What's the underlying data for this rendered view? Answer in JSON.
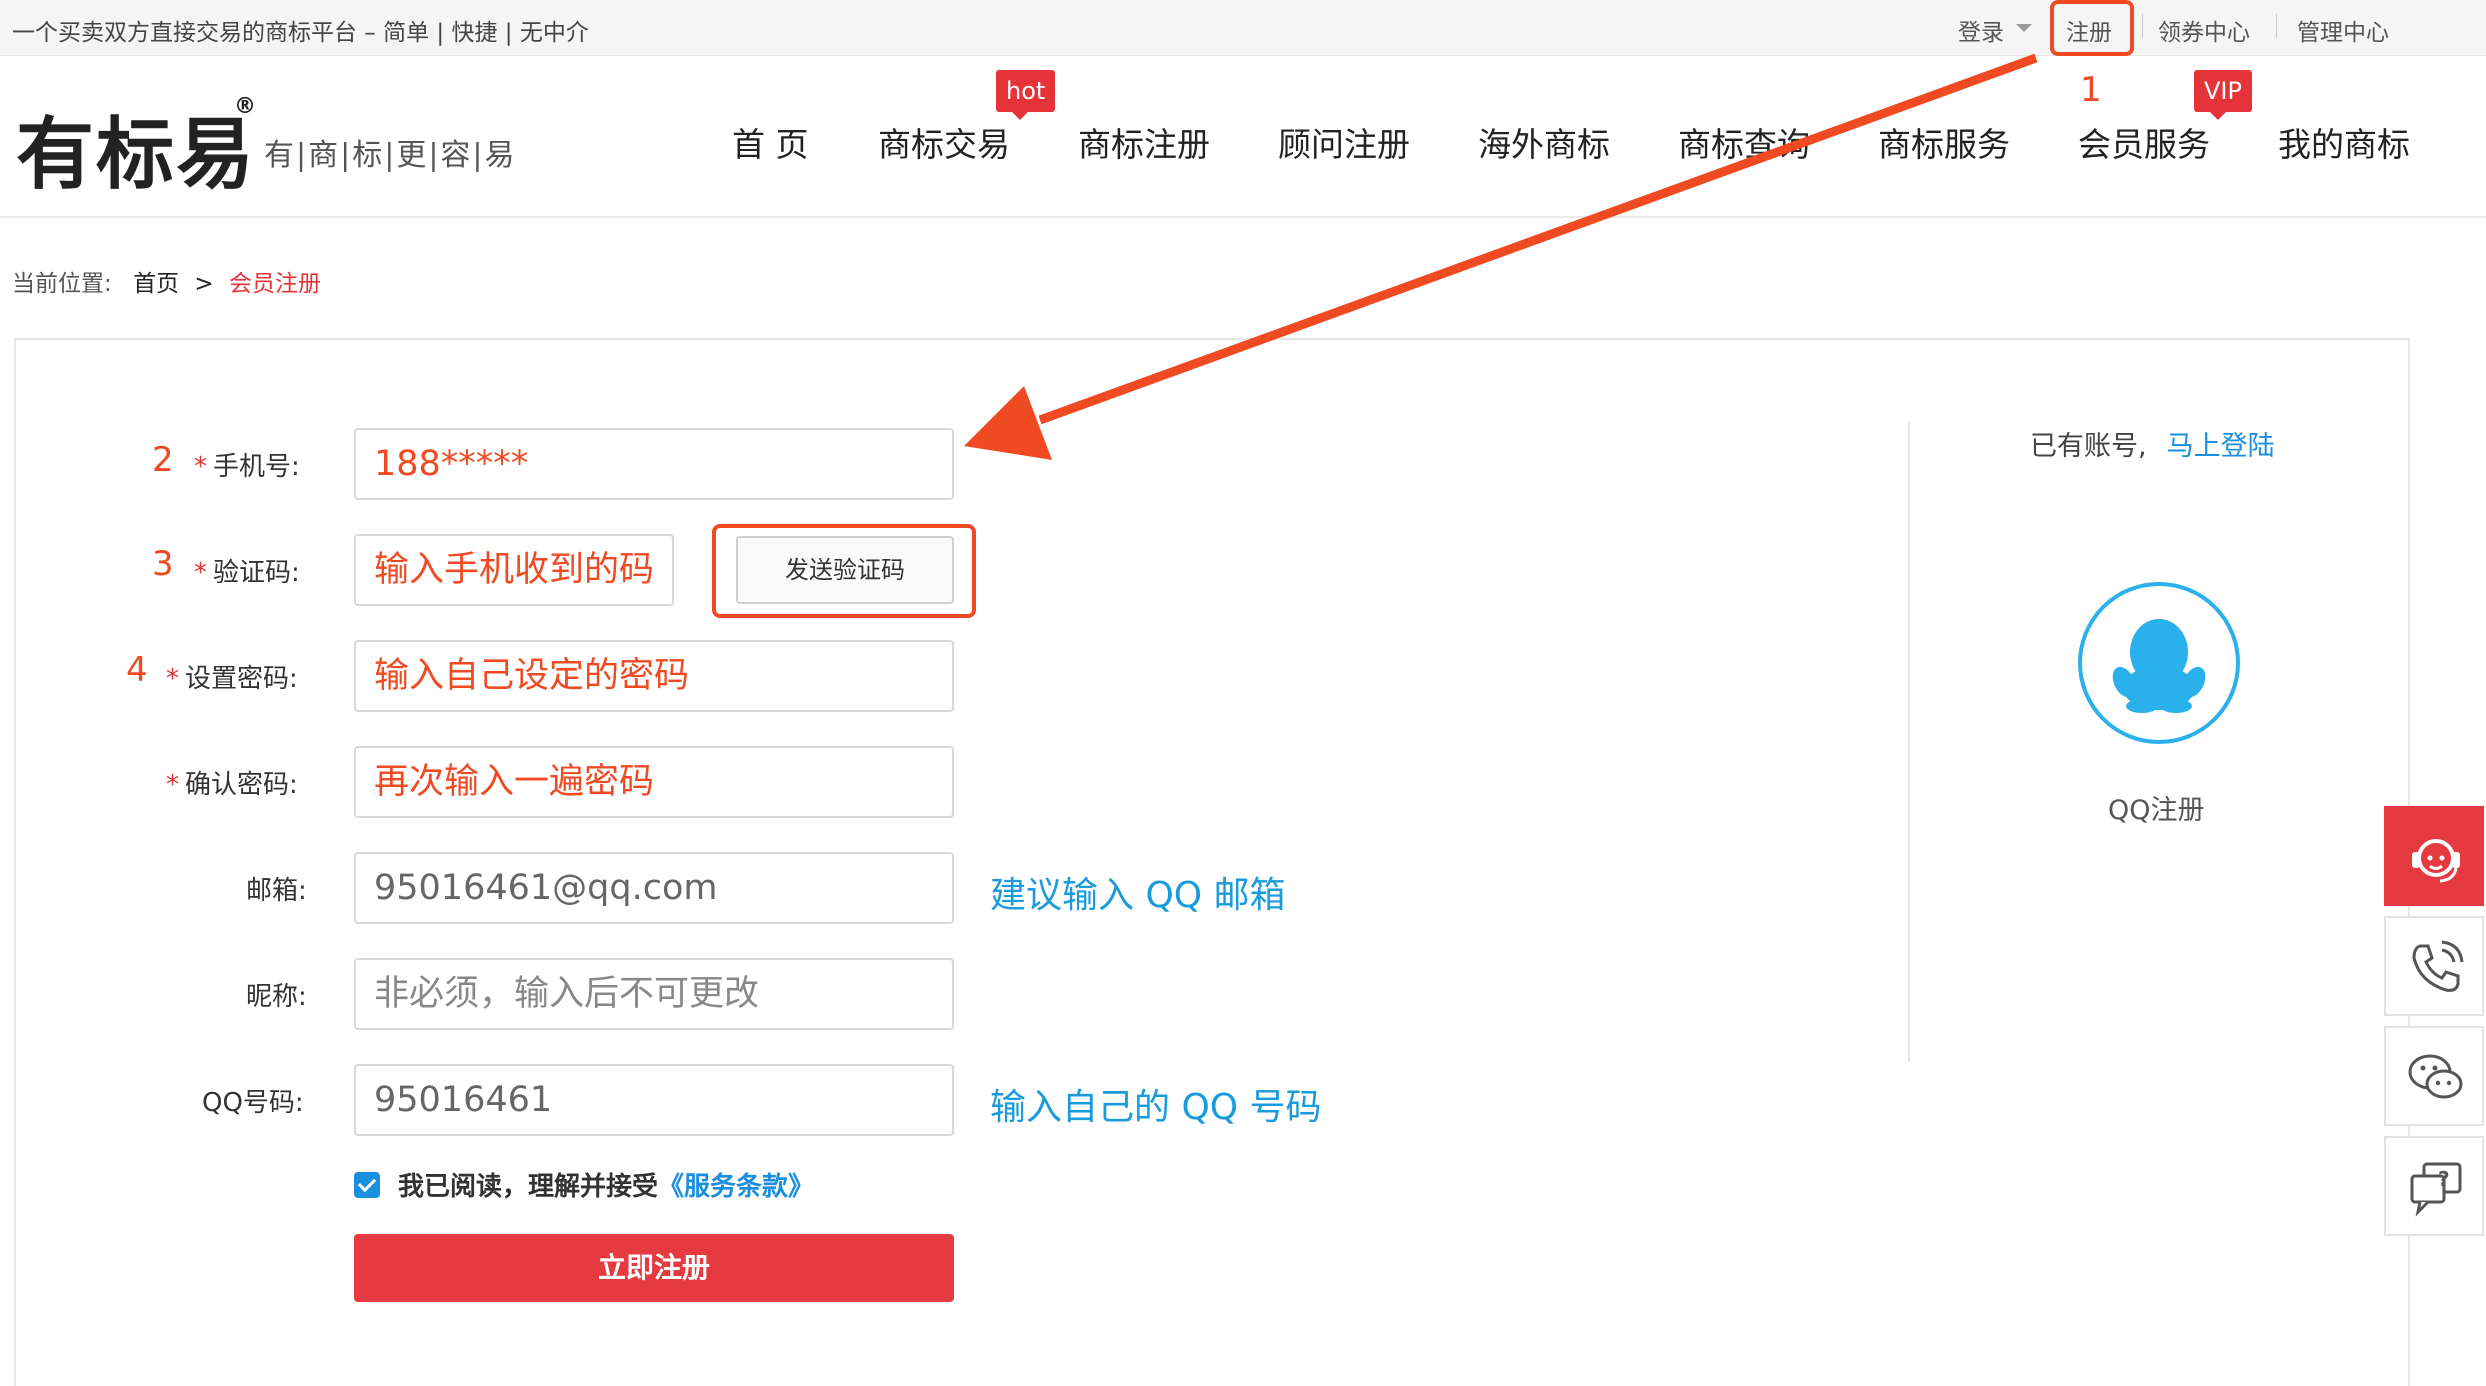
{
  "topbar": {
    "slogan": "一个买卖双方直接交易的商标平台 – 简单 | 快捷 | 无中介",
    "login": "登录",
    "register": "注册",
    "coupon": "领券中心",
    "manage": "管理中心"
  },
  "logo": {
    "name": "有标易",
    "reg": "®",
    "tagline": "有|商|标|更|容|易"
  },
  "nav": {
    "items": [
      "首 页",
      "商标交易",
      "商标注册",
      "顾问注册",
      "海外商标",
      "商标查询",
      "商标服务",
      "会员服务",
      "我的商标"
    ],
    "badges": {
      "hot": "hot",
      "vip": "VIP"
    }
  },
  "annotations": {
    "n1": "1",
    "n2": "2",
    "n3": "3",
    "n4": "4"
  },
  "breadcrumb": {
    "label": "当前位置:",
    "home": "首页",
    "sep": ">",
    "current": "会员注册"
  },
  "form": {
    "phone": {
      "label": "手机号:",
      "value": "188*****"
    },
    "code": {
      "label": "验证码:",
      "value": "输入手机收到的码",
      "send": "发送验证码"
    },
    "password": {
      "label": "设置密码:",
      "value": "输入自己设定的密码"
    },
    "confirm": {
      "label": "确认密码:",
      "value": "再次输入一遍密码"
    },
    "email": {
      "label": "邮箱:",
      "value": "95016461@qq.com",
      "hint": "建议输入 QQ 邮箱"
    },
    "nickname": {
      "label": "昵称:",
      "placeholder": "非必须，输入后不可更改"
    },
    "qq": {
      "label": "QQ号码:",
      "value": "95016461",
      "hint": "输入自己的 QQ 号码"
    },
    "required_mark": "*",
    "agree_text": "我已阅读，理解并接受",
    "terms": "《服务条款》",
    "submit": "立即注册"
  },
  "side_panel": {
    "have_account": "已有账号,",
    "login_now": "马上登陆",
    "qq_register": "QQ注册"
  },
  "colors": {
    "accent_red": "#e53a3f",
    "annotation": "#f04a23",
    "link_blue": "#1a8fdf",
    "hint_blue": "#1a9bdc"
  },
  "icons": [
    "qq-penguin-icon",
    "customer-service-icon",
    "phone-icon",
    "wechat-icon",
    "help-icon",
    "checkbox-checked-icon"
  ]
}
